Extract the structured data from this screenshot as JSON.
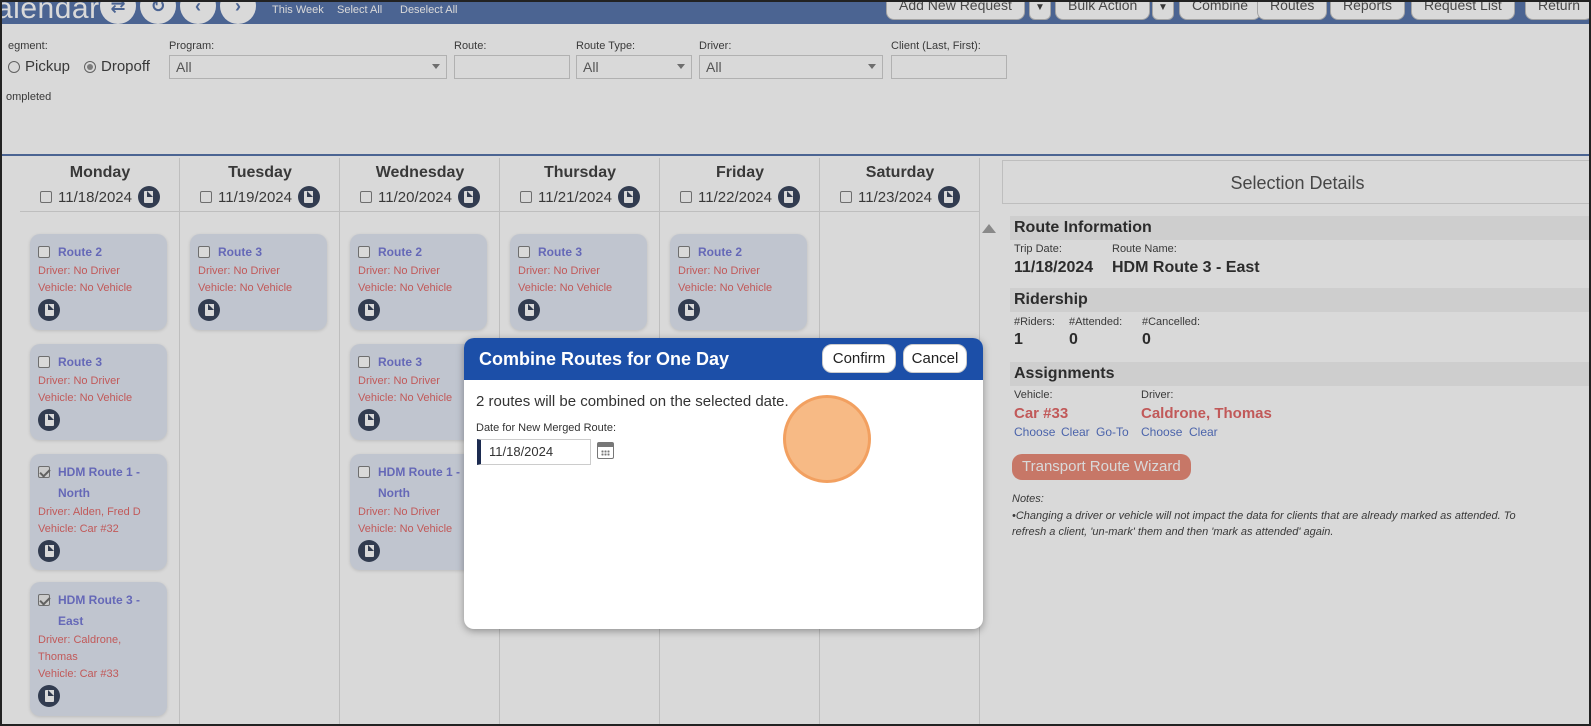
{
  "header": {
    "title": "alendar",
    "links": [
      "This Week",
      "Select All",
      "Deselect All"
    ],
    "buttons": {
      "add_new_request": "Add New Request",
      "bulk_action": "Bulk Action",
      "combine": "Combine",
      "routes": "Routes",
      "reports": "Reports",
      "request_list": "Request List",
      "return": "Return"
    }
  },
  "filters": {
    "segment_label": "egment:",
    "segment_options": [
      "Pickup",
      "Dropoff"
    ],
    "segment_selected": "Dropoff",
    "program_label": "Program:",
    "program_value": "All",
    "route_label": "Route:",
    "route_value": "",
    "route_type_label": "Route Type:",
    "route_type_value": "All",
    "driver_label": "Driver:",
    "driver_value": "All",
    "client_label": "Client (Last, First):",
    "client_value": "",
    "completed_label": "ompleted"
  },
  "calendar": {
    "days": [
      {
        "name": "Monday",
        "date": "11/18/2024",
        "cards": [
          {
            "title": "Route 2",
            "checked": false,
            "lines": [
              "Driver: No Driver",
              "Vehicle: No Vehicle"
            ]
          },
          {
            "title": "Route 3",
            "checked": false,
            "lines": [
              "Driver: No Driver",
              "Vehicle: No Vehicle"
            ]
          },
          {
            "title": "HDM Route 1 - North",
            "checked": true,
            "lines": [
              "Driver: Alden, Fred D",
              "Vehicle: Car #32"
            ]
          },
          {
            "title": "HDM Route 3 - East",
            "checked": true,
            "lines": [
              "Driver: Caldrone, Thomas",
              "Vehicle: Car #33"
            ]
          }
        ]
      },
      {
        "name": "Tuesday",
        "date": "11/19/2024",
        "cards": [
          {
            "title": "Route 3",
            "checked": false,
            "lines": [
              "Driver: No Driver",
              "Vehicle: No Vehicle"
            ]
          }
        ]
      },
      {
        "name": "Wednesday",
        "date": "11/20/2024",
        "cards": [
          {
            "title": "Route 2",
            "checked": false,
            "lines": [
              "Driver: No Driver",
              "Vehicle: No Vehicle"
            ]
          },
          {
            "title": "Route 3",
            "checked": false,
            "lines": [
              "Driver: No Driver",
              "Vehicle: No Vehicle"
            ]
          },
          {
            "title": "HDM Route 1 - North",
            "checked": false,
            "lines": [
              "Driver: No Driver",
              "Vehicle: No Vehicle"
            ]
          }
        ]
      },
      {
        "name": "Thursday",
        "date": "11/21/2024",
        "cards": [
          {
            "title": "Route 3",
            "checked": false,
            "lines": [
              "Driver: No Driver",
              "Vehicle: No Vehicle"
            ]
          }
        ]
      },
      {
        "name": "Friday",
        "date": "11/22/2024",
        "cards": [
          {
            "title": "Route 2",
            "checked": false,
            "lines": [
              "Driver: No Driver",
              "Vehicle: No Vehicle"
            ]
          }
        ]
      },
      {
        "name": "Saturday",
        "date": "11/23/2024",
        "cards": []
      }
    ]
  },
  "selection_details": {
    "title": "Selection Details",
    "route_info": {
      "heading": "Route Information",
      "trip_date_label": "Trip Date:",
      "trip_date": "11/18/2024",
      "route_name_label": "Route Name:",
      "route_name": "HDM Route 3 - East"
    },
    "ridership": {
      "heading": "Ridership",
      "riders_label": "#Riders:",
      "riders": "1",
      "attended_label": "#Attended:",
      "attended": "0",
      "cancelled_label": "#Cancelled:",
      "cancelled": "0"
    },
    "assignments": {
      "heading": "Assignments",
      "vehicle_label": "Vehicle:",
      "vehicle": "Car #33",
      "vehicle_links": [
        "Choose",
        "Clear",
        "Go-To"
      ],
      "driver_label": "Driver:",
      "driver": "Caldrone, Thomas",
      "driver_links": [
        "Choose",
        "Clear"
      ]
    },
    "wizard_button": "Transport Route Wizard",
    "notes_label": "Notes:",
    "notes_line1": "•Changing a driver or vehicle will not impact the data for clients that are already marked as attended. To",
    "notes_line2": "refresh a client, 'un-mark' them and then 'mark as attended' again."
  },
  "modal": {
    "title": "Combine Routes for One Day",
    "confirm": "Confirm",
    "cancel": "Cancel",
    "message": "2 routes will be combined on the selected date.",
    "date_label": "Date for New Merged Route:",
    "date_value": "11/18/2024"
  },
  "colors": {
    "header_bar": "#4a69a4",
    "modal_header": "#1c4fa8",
    "card_bg": "#dfe6f3",
    "card_title": "#6b6fd4",
    "card_text": "#e15b5b",
    "wizard_button": "#e8826e",
    "cursor_highlight": "#f6ae70"
  },
  "icons": [
    "arrows-icon",
    "refresh-icon",
    "chevron-left-icon",
    "chevron-right-icon",
    "document-icon",
    "calendar-icon",
    "caret-down-icon",
    "scroll-up-icon"
  ]
}
